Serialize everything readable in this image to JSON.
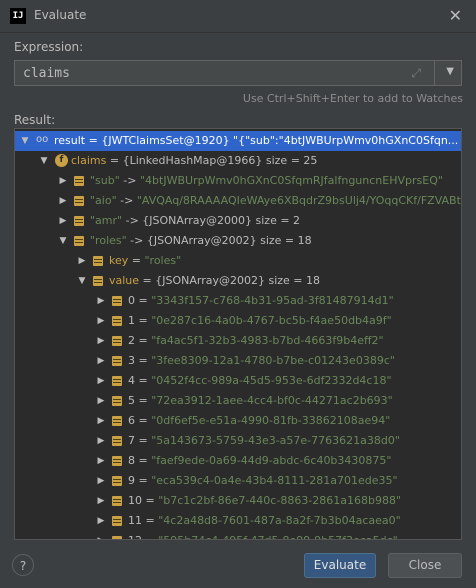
{
  "window": {
    "title": "Evaluate",
    "app_icon_text": "IJ"
  },
  "expression": {
    "label": "Expression:",
    "value": "claims"
  },
  "hint": "Use Ctrl+Shift+Enter to add to Watches",
  "result_label": "Result:",
  "tree": [
    {
      "indent": 0,
      "arrow": "down",
      "icon": "glasses",
      "selected": true,
      "name": "result",
      "idx": false,
      "text": " = {JWTClaimsSet@1920} \"{\"sub\":\"4btJWBUrpWmv0hGXnC0Sfqn... View"
    },
    {
      "indent": 1,
      "arrow": "down",
      "icon": "finfo",
      "name": "claims",
      "idx": false,
      "text": " = {LinkedHashMap@1966}  size = 25"
    },
    {
      "indent": 2,
      "arrow": "right",
      "icon": "field",
      "str1": "\"sub\"",
      "mid": " -> ",
      "str2": "\"4btJWBUrpWmv0hGXnC0SfqmRJfalfnguncnEHVprsEQ\""
    },
    {
      "indent": 2,
      "arrow": "right",
      "icon": "field",
      "str1": "\"aio\"",
      "mid": " -> ",
      "str2": "\"AVQAq/8RAAAAQIeWAye6XBqdrZ9bsUlj4/YOqqCKf/FZVABt"
    },
    {
      "indent": 2,
      "arrow": "right",
      "icon": "field",
      "str1": "\"amr\"",
      "mid": " -> {JSONArray@2000}  size = 2",
      "str2": ""
    },
    {
      "indent": 2,
      "arrow": "down",
      "icon": "field",
      "str1": "\"roles\"",
      "mid": " -> {JSONArray@2002}  size = 18",
      "str2": ""
    },
    {
      "indent": 3,
      "arrow": "right",
      "icon": "field",
      "name": "key",
      "idx": false,
      "text": " = ",
      "str2": "\"roles\""
    },
    {
      "indent": 3,
      "arrow": "down",
      "icon": "field",
      "name": "value",
      "idx": false,
      "text": " = {JSONArray@2002}  size = 18"
    },
    {
      "indent": 4,
      "arrow": "right",
      "icon": "field",
      "name": "0",
      "idx": true,
      "text": " = ",
      "str2": "\"3343f157-c768-4b31-95ad-3f81487914d1\""
    },
    {
      "indent": 4,
      "arrow": "right",
      "icon": "field",
      "name": "1",
      "idx": true,
      "text": " = ",
      "str2": "\"0e287c16-4a0b-4767-bc5b-f4ae50db4a9f\""
    },
    {
      "indent": 4,
      "arrow": "right",
      "icon": "field",
      "name": "2",
      "idx": true,
      "text": " = ",
      "str2": "\"fa4ac5f1-32b3-4983-b7bd-4663f9b4eff2\""
    },
    {
      "indent": 4,
      "arrow": "right",
      "icon": "field",
      "name": "3",
      "idx": true,
      "text": " = ",
      "str2": "\"3fee8309-12a1-4780-b7be-c01243e0389c\""
    },
    {
      "indent": 4,
      "arrow": "right",
      "icon": "field",
      "name": "4",
      "idx": true,
      "text": " = ",
      "str2": "\"0452f4cc-989a-45d5-953e-6df2332d4c18\""
    },
    {
      "indent": 4,
      "arrow": "right",
      "icon": "field",
      "name": "5",
      "idx": true,
      "text": " = ",
      "str2": "\"72ea3912-1aee-4cc4-bf0c-44271ac2b693\""
    },
    {
      "indent": 4,
      "arrow": "right",
      "icon": "field",
      "name": "6",
      "idx": true,
      "text": " = ",
      "str2": "\"0df6ef5e-e51a-4990-81fb-33862108ae94\""
    },
    {
      "indent": 4,
      "arrow": "right",
      "icon": "field",
      "name": "7",
      "idx": true,
      "text": " = ",
      "str2": "\"5a143673-5759-43e3-a57e-7763621a38d0\""
    },
    {
      "indent": 4,
      "arrow": "right",
      "icon": "field",
      "name": "8",
      "idx": true,
      "text": " = ",
      "str2": "\"faef9ede-0a69-44d9-abdc-6c40b3430875\""
    },
    {
      "indent": 4,
      "arrow": "right",
      "icon": "field",
      "name": "9",
      "idx": true,
      "text": " = ",
      "str2": "\"eca539c4-0a4e-43b4-8111-281a701ede35\""
    },
    {
      "indent": 4,
      "arrow": "right",
      "icon": "field",
      "name": "10",
      "idx": true,
      "text": " = ",
      "str2": "\"b7c1c2bf-86e7-440c-8863-2861a168b988\""
    },
    {
      "indent": 4,
      "arrow": "right",
      "icon": "field",
      "name": "11",
      "idx": true,
      "text": " = ",
      "str2": "\"4c2a48d8-7601-487a-8a2f-7b3b04acaea0\""
    },
    {
      "indent": 4,
      "arrow": "right",
      "icon": "field",
      "name": "12",
      "idx": true,
      "text": " = ",
      "str2": "\"595b74c4-495f-47d5-8e99-9b57f3eca5dc\""
    }
  ],
  "buttons": {
    "help": "?",
    "evaluate": "Evaluate",
    "close": "Close"
  }
}
